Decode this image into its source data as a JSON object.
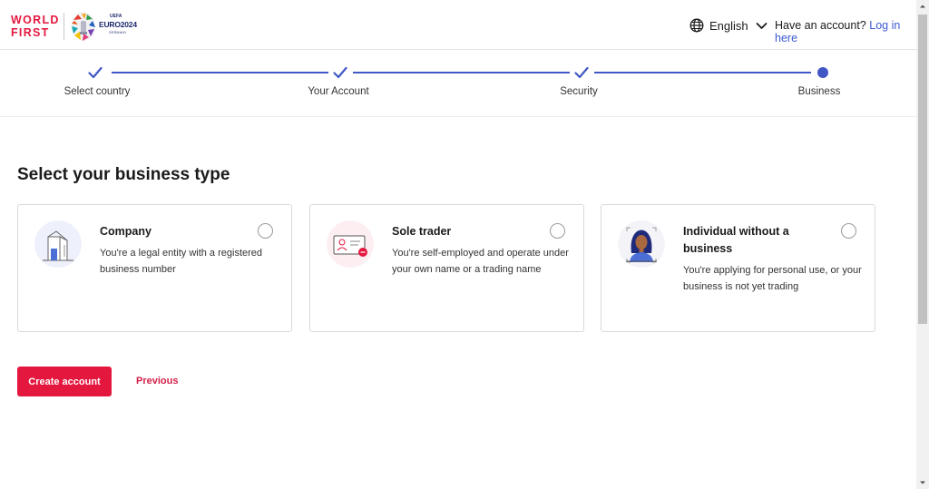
{
  "header": {
    "logo_line1": "WORLD",
    "logo_line2": "FIRST",
    "partner_top": "UEFA",
    "partner_name": "EURO2024",
    "partner_sub": "GERMANY",
    "language": "English",
    "account_prompt": "Have an account?",
    "login_link": "Log in here"
  },
  "stepper": {
    "steps": [
      {
        "label": "Select country",
        "status": "complete"
      },
      {
        "label": "Your Account",
        "status": "complete"
      },
      {
        "label": "Security",
        "status": "complete"
      },
      {
        "label": "Business",
        "status": "current"
      }
    ]
  },
  "main": {
    "title": "Select your business type",
    "options": [
      {
        "title": "Company",
        "description": "You're a legal entity with a registered business number",
        "icon": "building-icon",
        "selected": false
      },
      {
        "title": "Sole trader",
        "description": "You're self-employed and operate under your own name or a trading name",
        "icon": "id-card-icon",
        "selected": false
      },
      {
        "title": "Individual without a business",
        "description": "You're applying for personal use, or your business is not yet trading",
        "icon": "person-icon",
        "selected": false
      }
    ],
    "primary_button": "Create account",
    "secondary_button": "Previous"
  },
  "colors": {
    "brand_red": "#e4173e",
    "accent_blue": "#4158c4",
    "link_blue": "#3c5ad1"
  }
}
